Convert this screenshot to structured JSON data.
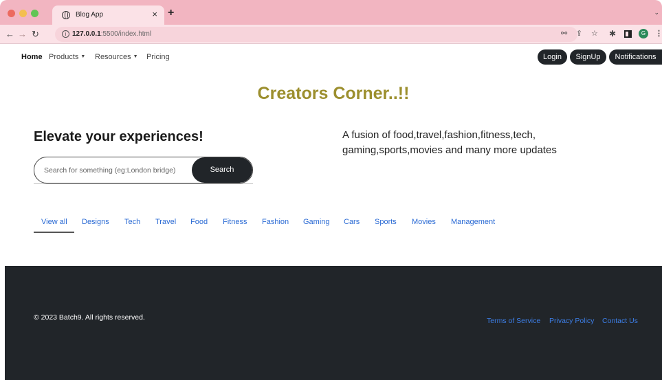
{
  "browser": {
    "tab_title": "Blog App",
    "tab_close": "×",
    "new_tab": "+",
    "url_host": "127.0.0.1",
    "url_path": ":5500/index.html",
    "profile_initial": "G"
  },
  "nav": {
    "home": "Home",
    "products": "Products",
    "resources": "Resources",
    "pricing": "Pricing",
    "login": "Login",
    "signup": "SignUp",
    "notifications": "Notifications"
  },
  "hero": {
    "title": "Creators Corner..!!",
    "heading": "Elevate your experiences!",
    "tagline": "A fusion of food,travel,fashion,fitness,tech, gaming,sports,movies and many more updates"
  },
  "search": {
    "placeholder": "Search for something (eg:London bridge)",
    "button": "Search"
  },
  "categories": [
    "View all",
    "Designs",
    "Tech",
    "Travel",
    "Food",
    "Fitness",
    "Fashion",
    "Gaming",
    "Cars",
    "Sports",
    "Movies",
    "Management"
  ],
  "footer": {
    "copyright": "© 2023 Batch9. All rights reserved.",
    "terms": "Terms of Service",
    "privacy": "Privacy Policy",
    "contact": "Contact Us"
  },
  "colors": {
    "accent_title": "#9c8f2e",
    "dark": "#212529",
    "link": "#2a6ad4",
    "tab_bar": "#f2b5c1"
  }
}
